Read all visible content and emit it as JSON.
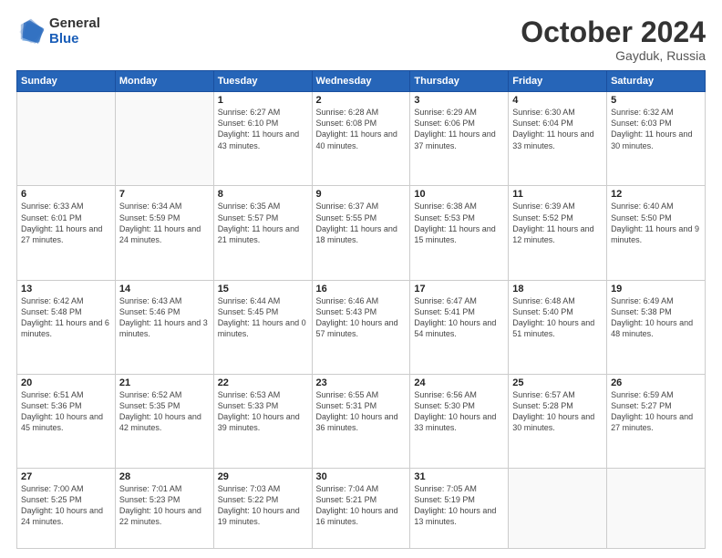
{
  "logo": {
    "general": "General",
    "blue": "Blue"
  },
  "header": {
    "month": "October 2024",
    "location": "Gayduk, Russia"
  },
  "days_of_week": [
    "Sunday",
    "Monday",
    "Tuesday",
    "Wednesday",
    "Thursday",
    "Friday",
    "Saturday"
  ],
  "weeks": [
    [
      {
        "day": "",
        "info": ""
      },
      {
        "day": "",
        "info": ""
      },
      {
        "day": "1",
        "info": "Sunrise: 6:27 AM\nSunset: 6:10 PM\nDaylight: 11 hours and 43 minutes."
      },
      {
        "day": "2",
        "info": "Sunrise: 6:28 AM\nSunset: 6:08 PM\nDaylight: 11 hours and 40 minutes."
      },
      {
        "day": "3",
        "info": "Sunrise: 6:29 AM\nSunset: 6:06 PM\nDaylight: 11 hours and 37 minutes."
      },
      {
        "day": "4",
        "info": "Sunrise: 6:30 AM\nSunset: 6:04 PM\nDaylight: 11 hours and 33 minutes."
      },
      {
        "day": "5",
        "info": "Sunrise: 6:32 AM\nSunset: 6:03 PM\nDaylight: 11 hours and 30 minutes."
      }
    ],
    [
      {
        "day": "6",
        "info": "Sunrise: 6:33 AM\nSunset: 6:01 PM\nDaylight: 11 hours and 27 minutes."
      },
      {
        "day": "7",
        "info": "Sunrise: 6:34 AM\nSunset: 5:59 PM\nDaylight: 11 hours and 24 minutes."
      },
      {
        "day": "8",
        "info": "Sunrise: 6:35 AM\nSunset: 5:57 PM\nDaylight: 11 hours and 21 minutes."
      },
      {
        "day": "9",
        "info": "Sunrise: 6:37 AM\nSunset: 5:55 PM\nDaylight: 11 hours and 18 minutes."
      },
      {
        "day": "10",
        "info": "Sunrise: 6:38 AM\nSunset: 5:53 PM\nDaylight: 11 hours and 15 minutes."
      },
      {
        "day": "11",
        "info": "Sunrise: 6:39 AM\nSunset: 5:52 PM\nDaylight: 11 hours and 12 minutes."
      },
      {
        "day": "12",
        "info": "Sunrise: 6:40 AM\nSunset: 5:50 PM\nDaylight: 11 hours and 9 minutes."
      }
    ],
    [
      {
        "day": "13",
        "info": "Sunrise: 6:42 AM\nSunset: 5:48 PM\nDaylight: 11 hours and 6 minutes."
      },
      {
        "day": "14",
        "info": "Sunrise: 6:43 AM\nSunset: 5:46 PM\nDaylight: 11 hours and 3 minutes."
      },
      {
        "day": "15",
        "info": "Sunrise: 6:44 AM\nSunset: 5:45 PM\nDaylight: 11 hours and 0 minutes."
      },
      {
        "day": "16",
        "info": "Sunrise: 6:46 AM\nSunset: 5:43 PM\nDaylight: 10 hours and 57 minutes."
      },
      {
        "day": "17",
        "info": "Sunrise: 6:47 AM\nSunset: 5:41 PM\nDaylight: 10 hours and 54 minutes."
      },
      {
        "day": "18",
        "info": "Sunrise: 6:48 AM\nSunset: 5:40 PM\nDaylight: 10 hours and 51 minutes."
      },
      {
        "day": "19",
        "info": "Sunrise: 6:49 AM\nSunset: 5:38 PM\nDaylight: 10 hours and 48 minutes."
      }
    ],
    [
      {
        "day": "20",
        "info": "Sunrise: 6:51 AM\nSunset: 5:36 PM\nDaylight: 10 hours and 45 minutes."
      },
      {
        "day": "21",
        "info": "Sunrise: 6:52 AM\nSunset: 5:35 PM\nDaylight: 10 hours and 42 minutes."
      },
      {
        "day": "22",
        "info": "Sunrise: 6:53 AM\nSunset: 5:33 PM\nDaylight: 10 hours and 39 minutes."
      },
      {
        "day": "23",
        "info": "Sunrise: 6:55 AM\nSunset: 5:31 PM\nDaylight: 10 hours and 36 minutes."
      },
      {
        "day": "24",
        "info": "Sunrise: 6:56 AM\nSunset: 5:30 PM\nDaylight: 10 hours and 33 minutes."
      },
      {
        "day": "25",
        "info": "Sunrise: 6:57 AM\nSunset: 5:28 PM\nDaylight: 10 hours and 30 minutes."
      },
      {
        "day": "26",
        "info": "Sunrise: 6:59 AM\nSunset: 5:27 PM\nDaylight: 10 hours and 27 minutes."
      }
    ],
    [
      {
        "day": "27",
        "info": "Sunrise: 7:00 AM\nSunset: 5:25 PM\nDaylight: 10 hours and 24 minutes."
      },
      {
        "day": "28",
        "info": "Sunrise: 7:01 AM\nSunset: 5:23 PM\nDaylight: 10 hours and 22 minutes."
      },
      {
        "day": "29",
        "info": "Sunrise: 7:03 AM\nSunset: 5:22 PM\nDaylight: 10 hours and 19 minutes."
      },
      {
        "day": "30",
        "info": "Sunrise: 7:04 AM\nSunset: 5:21 PM\nDaylight: 10 hours and 16 minutes."
      },
      {
        "day": "31",
        "info": "Sunrise: 7:05 AM\nSunset: 5:19 PM\nDaylight: 10 hours and 13 minutes."
      },
      {
        "day": "",
        "info": ""
      },
      {
        "day": "",
        "info": ""
      }
    ]
  ]
}
